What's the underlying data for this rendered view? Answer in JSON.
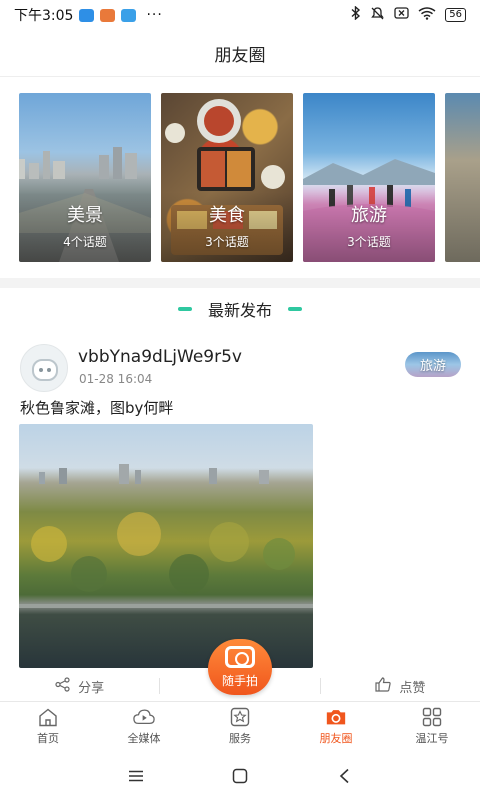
{
  "status_bar": {
    "time": "下午3:05",
    "more": "···",
    "battery": "56"
  },
  "header": {
    "title": "朋友圈"
  },
  "topics": [
    {
      "name": "美景",
      "count": "4个话题"
    },
    {
      "name": "美食",
      "count": "3个话题"
    },
    {
      "name": "旅游",
      "count": "3个话题"
    }
  ],
  "section": {
    "title": "最新发布"
  },
  "post": {
    "username": "vbbYna9dLjWe9r5v",
    "time": "01-28 16:04",
    "tag": "旅游",
    "text": "秋色鲁家滩，图by何畔"
  },
  "actions": {
    "share": "分享",
    "like": "点赞"
  },
  "fab": {
    "label": "随手拍"
  },
  "bottom_nav": [
    {
      "label": "首页",
      "icon": "home-icon"
    },
    {
      "label": "全媒体",
      "icon": "media-icon"
    },
    {
      "label": "服务",
      "icon": "service-star-icon"
    },
    {
      "label": "朋友圈",
      "icon": "camera-icon",
      "active": true
    },
    {
      "label": "温江号",
      "icon": "grid-icon"
    }
  ],
  "colors": {
    "accent": "#f0561d",
    "section_dash": "#2fc8a0"
  }
}
